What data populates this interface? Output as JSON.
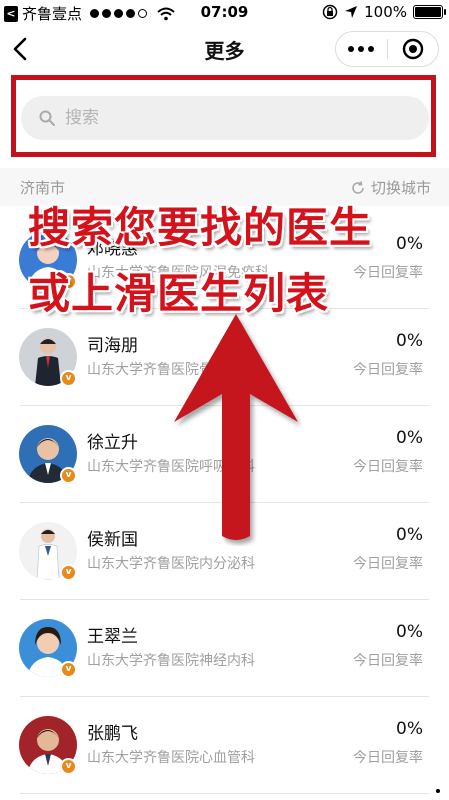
{
  "status_bar": {
    "carrier": "齐鲁壹点",
    "time": "07:09",
    "battery": "100%"
  },
  "nav": {
    "title": "更多"
  },
  "search": {
    "placeholder": "搜索"
  },
  "city_bar": {
    "city": "济南市",
    "switch_label": "切换城市"
  },
  "doctors": [
    {
      "name": "邓晓惠",
      "hospital": "山东大学齐鲁医院风湿免疫科",
      "rate": "0%",
      "rate_label": "今日回复率",
      "avatar_bg": "#3a7bd5"
    },
    {
      "name": "司海朋",
      "hospital": "山东大学齐鲁医院骨科",
      "rate": "0%",
      "rate_label": "今日回复率",
      "avatar_bg": "#cfd3d8"
    },
    {
      "name": "徐立升",
      "hospital": "山东大学齐鲁医院呼吸内科",
      "rate": "0%",
      "rate_label": "今日回复率",
      "avatar_bg": "#2f6fb5"
    },
    {
      "name": "侯新国",
      "hospital": "山东大学齐鲁医院内分泌科",
      "rate": "0%",
      "rate_label": "今日回复率",
      "avatar_bg": "#f2f2f2"
    },
    {
      "name": "王翠兰",
      "hospital": "山东大学齐鲁医院神经内科",
      "rate": "0%",
      "rate_label": "今日回复率",
      "avatar_bg": "#3b8fd9"
    },
    {
      "name": "张鹏飞",
      "hospital": "山东大学齐鲁医院心血管科",
      "rate": "0%",
      "rate_label": "今日回复率",
      "avatar_bg": "#a3232a"
    }
  ],
  "annotation": {
    "line1": "搜索您要找的医生",
    "line2": "或上滑医生列表",
    "color": "#d4121c"
  },
  "badge_glyph": "v",
  "icons": [
    "back-app-icon",
    "wifi-icon",
    "lock-rotation-icon",
    "location-icon",
    "battery-icon",
    "back-icon",
    "more-icon",
    "close-icon",
    "search-icon",
    "refresh-icon",
    "verified-badge-icon",
    "up-arrow-icon"
  ]
}
